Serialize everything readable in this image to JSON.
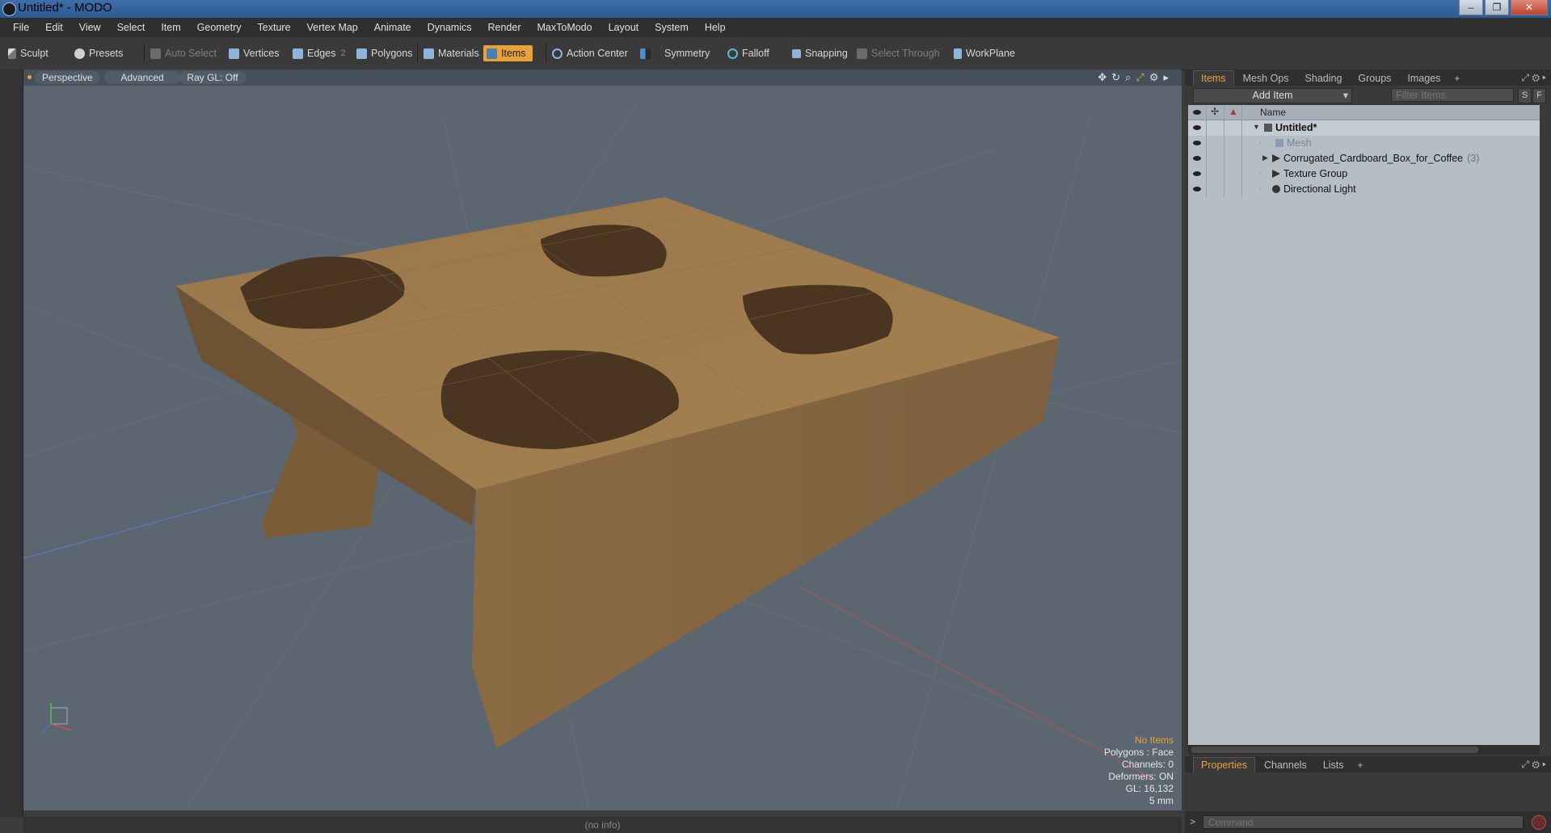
{
  "window": {
    "title": "Untitled* - MODO",
    "controls": [
      "–",
      "❐",
      "✕"
    ]
  },
  "menu": [
    "File",
    "Edit",
    "View",
    "Select",
    "Item",
    "Geometry",
    "Texture",
    "Vertex Map",
    "Animate",
    "Dynamics",
    "Render",
    "MaxToModo",
    "Layout",
    "System",
    "Help"
  ],
  "toolbar": {
    "sculpt": "Sculpt",
    "presets": "Presets",
    "auto_select": "Auto Select",
    "vertices": "Vertices",
    "edges": "Edges",
    "edges_badge": "2",
    "polygons": "Polygons",
    "materials": "Materials",
    "items": "Items",
    "action_center": "Action Center",
    "symmetry": "Symmetry",
    "falloff": "Falloff",
    "snapping": "Snapping",
    "select_through": "Select Through",
    "workplane": "WorkPlane"
  },
  "viewport": {
    "view": "Perspective",
    "mode": "Advanced",
    "raygl": "Ray GL: Off",
    "hud": {
      "items": "No Items",
      "polygons": "Polygons : Face",
      "channels": "Channels: 0",
      "deformers": "Deformers: ON",
      "gl": "GL: 16,132",
      "unit": "5 mm"
    }
  },
  "items_panel": {
    "tabs": [
      "Items",
      "Mesh Ops",
      "Shading",
      "Groups",
      "Images"
    ],
    "add_item": "Add Item",
    "filter_placeholder": "Filter Items",
    "s_btn": "S",
    "f_btn": "F",
    "column_name": "Name",
    "tree": [
      {
        "label": "Untitled*",
        "count": ""
      },
      {
        "label": "Mesh",
        "count": ""
      },
      {
        "label": "Corrugated_Cardboard_Box_for_Coffee",
        "count": "(3)"
      },
      {
        "label": "Texture Group",
        "count": ""
      },
      {
        "label": "Directional Light",
        "count": ""
      }
    ]
  },
  "properties_panel": {
    "tabs": [
      "Properties",
      "Channels",
      "Lists"
    ]
  },
  "command": {
    "prompt": ">",
    "placeholder": "Command"
  },
  "status": "(no info)",
  "colors": {
    "accent": "#e8a23a",
    "viewport_bg": "#5c6670",
    "cardboard": "#9c7a4e"
  }
}
